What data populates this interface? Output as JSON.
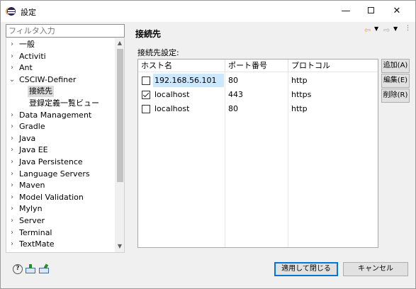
{
  "window": {
    "title": "設定",
    "minimize": "—",
    "close": "✕"
  },
  "filter": {
    "placeholder": "フィルタ入力"
  },
  "tree": {
    "items": [
      {
        "label": "一般",
        "caret": "›",
        "indent": 0
      },
      {
        "label": "Activiti",
        "caret": "›",
        "indent": 0
      },
      {
        "label": "Ant",
        "caret": "›",
        "indent": 0
      },
      {
        "label": "CSCIW-Definer",
        "caret": "⌄",
        "indent": 0
      },
      {
        "label": "接続先",
        "caret": "",
        "indent": 1,
        "selected": true
      },
      {
        "label": "登録定義一覧ビュー",
        "caret": "",
        "indent": 1
      },
      {
        "label": "Data Management",
        "caret": "›",
        "indent": 0
      },
      {
        "label": "Gradle",
        "caret": "›",
        "indent": 0
      },
      {
        "label": "Java",
        "caret": "›",
        "indent": 0
      },
      {
        "label": "Java EE",
        "caret": "›",
        "indent": 0
      },
      {
        "label": "Java Persistence",
        "caret": "›",
        "indent": 0
      },
      {
        "label": "Language Servers",
        "caret": "›",
        "indent": 0
      },
      {
        "label": "Maven",
        "caret": "›",
        "indent": 0
      },
      {
        "label": "Model Validation",
        "caret": "›",
        "indent": 0
      },
      {
        "label": "Mylyn",
        "caret": "›",
        "indent": 0
      },
      {
        "label": "Server",
        "caret": "›",
        "indent": 0
      },
      {
        "label": "Terminal",
        "caret": "›",
        "indent": 0
      },
      {
        "label": "TextMate",
        "caret": "›",
        "indent": 0
      }
    ]
  },
  "page": {
    "title": "接続先",
    "section_label": "接続先設定:",
    "columns": [
      "ホスト名",
      "ポート番号",
      "プロトコル"
    ],
    "rows": [
      {
        "checked": false,
        "host": "192.168.56.101",
        "port": "80",
        "protocol": "http",
        "highlighted": true
      },
      {
        "checked": true,
        "host": "localhost",
        "port": "443",
        "protocol": "https",
        "highlighted": false
      },
      {
        "checked": false,
        "host": "localhost",
        "port": "80",
        "protocol": "http",
        "highlighted": false
      }
    ],
    "buttons": {
      "add": "追加(A)",
      "edit": "編集(E)",
      "delete": "削除(R)"
    }
  },
  "footer": {
    "apply_close": "適用して閉じる",
    "cancel": "キャンセル",
    "help_glyph": "?"
  }
}
